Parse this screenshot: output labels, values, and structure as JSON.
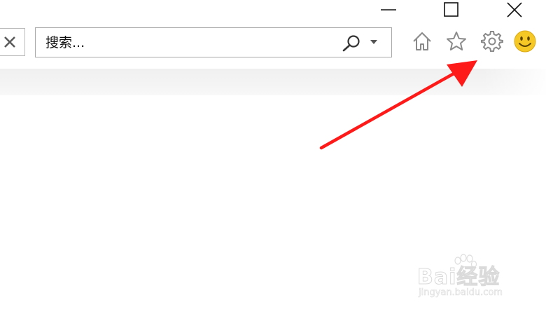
{
  "window_controls": {
    "minimize": "minimize",
    "maximize": "maximize",
    "close": "close"
  },
  "toolbar": {
    "stop_icon": "close-x-icon",
    "search": {
      "placeholder": "搜索...",
      "value": "",
      "icon": "magnifier-icon",
      "dropdown_icon": "chevron-down-icon"
    },
    "icons": [
      "home-icon",
      "favorites-star-icon",
      "settings-gear-icon",
      "feedback-smiley-icon"
    ]
  },
  "annotation": {
    "type": "arrow",
    "color": "#ff1a1a",
    "points_to": "settings-gear-icon"
  },
  "watermark": {
    "main": "Bai经验",
    "sub": "jingyan.baidu.com"
  },
  "colors": {
    "accent_arrow": "#ff1a1a",
    "smiley_face": "#f5c826",
    "icon_gray": "#8a8a8a"
  }
}
